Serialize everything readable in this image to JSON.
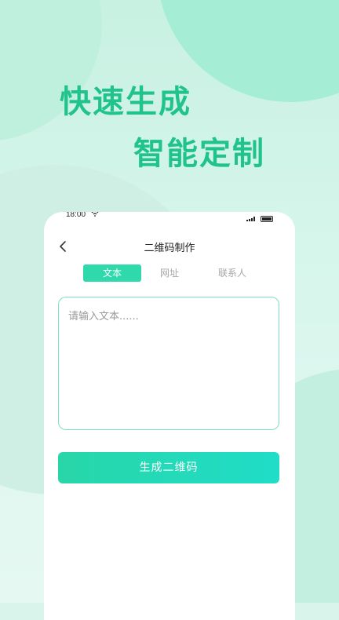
{
  "headline": {
    "line1": "快速生成",
    "line2": "智能定制"
  },
  "status_bar": {
    "time": "18:00",
    "wifi_icon": "wifi-icon",
    "signal_icon": "signal-icon",
    "battery_icon": "battery-icon"
  },
  "nav": {
    "back_icon": "back-chevron-icon",
    "title": "二维码制作"
  },
  "tabs": [
    {
      "label": "文本",
      "active": true
    },
    {
      "label": "网址",
      "active": false
    },
    {
      "label": "联系人",
      "active": false
    }
  ],
  "input": {
    "placeholder": "请输入文本......",
    "value": ""
  },
  "button": {
    "label": "生成二维码"
  },
  "colors": {
    "accent": "#21c38c",
    "tab_active": "#2fd9ab",
    "button_start": "#28d6a8",
    "button_end": "#20ddc8",
    "border": "#7fe0bf"
  }
}
